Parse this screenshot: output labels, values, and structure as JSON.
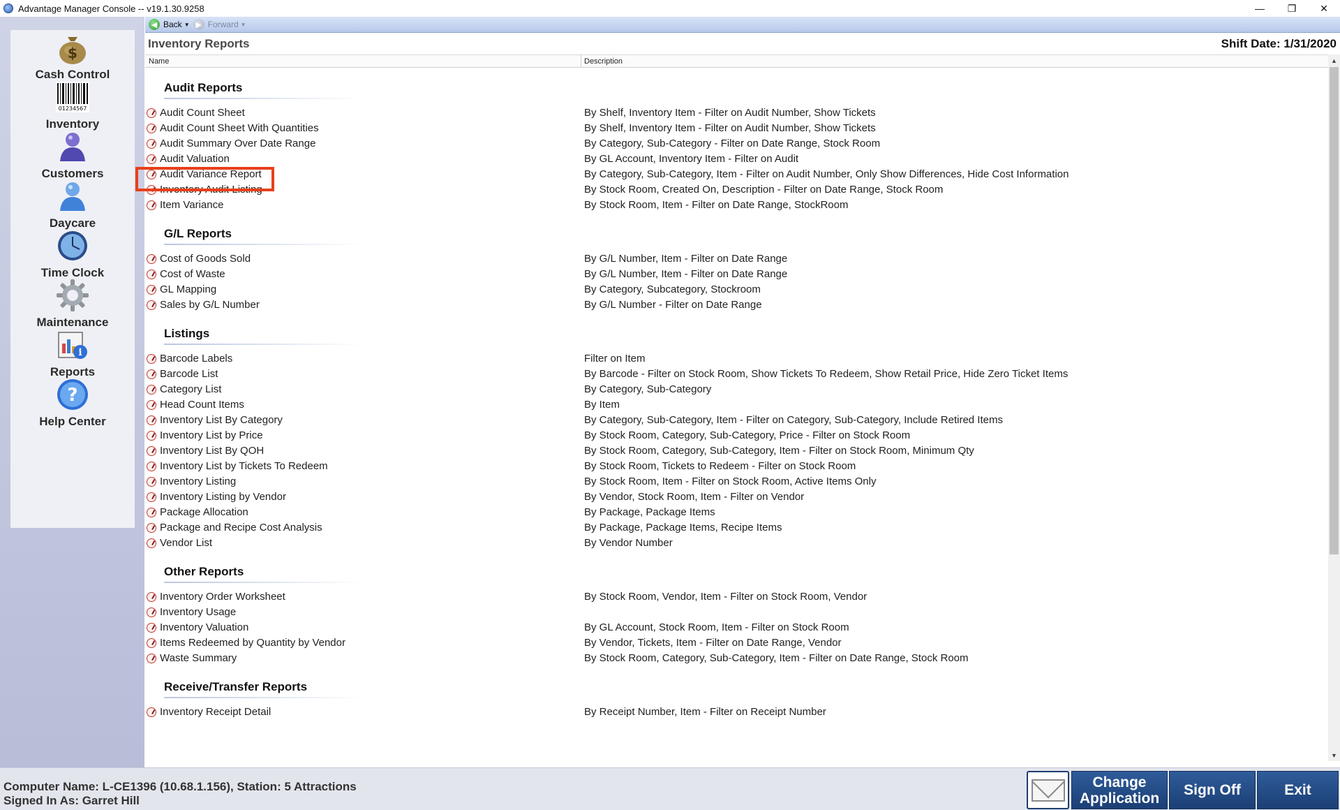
{
  "window": {
    "title": "Advantage Manager Console -- v19.1.30.9258",
    "minimize": "—",
    "restore": "❐",
    "close": "✕"
  },
  "sidebar": {
    "items": [
      {
        "label": "Cash Control",
        "icon": "money-bag-icon"
      },
      {
        "label": "Inventory",
        "icon": "barcode-icon"
      },
      {
        "label": "Customers",
        "icon": "customer-person-icon"
      },
      {
        "label": "Daycare",
        "icon": "daycare-person-icon"
      },
      {
        "label": "Time Clock",
        "icon": "clock-icon"
      },
      {
        "label": "Maintenance",
        "icon": "gear-icon"
      },
      {
        "label": "Reports",
        "icon": "reports-icon"
      },
      {
        "label": "Help Center",
        "icon": "help-icon"
      }
    ],
    "barcode_text": "01234567"
  },
  "navbar": {
    "back": "Back",
    "forward": "Forward"
  },
  "page": {
    "title": "Inventory Reports",
    "shift_date": "Shift Date: 1/31/2020"
  },
  "columns": {
    "name": "Name",
    "description": "Description"
  },
  "sections": [
    {
      "title": "Audit Reports",
      "rows": [
        {
          "name": "Audit Count Sheet",
          "desc": "By Shelf, Inventory Item - Filter on Audit Number, Show Tickets"
        },
        {
          "name": "Audit Count Sheet With Quantities",
          "desc": "By Shelf, Inventory Item - Filter on Audit Number, Show Tickets"
        },
        {
          "name": "Audit Summary Over Date Range",
          "desc": "By Category, Sub-Category - Filter on Date Range, Stock Room"
        },
        {
          "name": "Audit Valuation",
          "desc": "By GL Account, Inventory Item - Filter on Audit"
        },
        {
          "name": "Audit Variance Report",
          "desc": "By Category, Sub-Category, Item - Filter on Audit Number, Only Show Differences, Hide Cost Information"
        },
        {
          "name": "Inventory Audit Listing",
          "desc": "By Stock Room, Created On, Description - Filter on Date Range, Stock Room"
        },
        {
          "name": "Item Variance",
          "desc": "By Stock Room, Item - Filter on Date Range, StockRoom"
        }
      ]
    },
    {
      "title": "G/L Reports",
      "rows": [
        {
          "name": "Cost of Goods Sold",
          "desc": "By G/L Number, Item - Filter on Date Range"
        },
        {
          "name": "Cost of Waste",
          "desc": "By G/L Number, Item - Filter on Date Range"
        },
        {
          "name": "GL Mapping",
          "desc": "By Category, Subcategory, Stockroom"
        },
        {
          "name": "Sales by G/L Number",
          "desc": "By G/L Number - Filter on Date Range"
        }
      ]
    },
    {
      "title": "Listings",
      "rows": [
        {
          "name": "Barcode Labels",
          "desc": "Filter on Item"
        },
        {
          "name": "Barcode List",
          "desc": "By Barcode - Filter on Stock Room, Show Tickets To Redeem, Show Retail Price, Hide Zero Ticket Items"
        },
        {
          "name": "Category List",
          "desc": "By Category, Sub-Category"
        },
        {
          "name": "Head Count Items",
          "desc": "By Item"
        },
        {
          "name": "Inventory List By Category",
          "desc": "By Category, Sub-Category, Item - Filter on Category, Sub-Category, Include Retired Items"
        },
        {
          "name": "Inventory List by Price",
          "desc": "By Stock Room, Category, Sub-Category, Price - Filter on Stock Room"
        },
        {
          "name": "Inventory List By QOH",
          "desc": "By Stock Room, Category, Sub-Category, Item - Filter on Stock Room, Minimum Qty"
        },
        {
          "name": "Inventory List by Tickets To Redeem",
          "desc": "By Stock Room, Tickets to Redeem - Filter on Stock Room"
        },
        {
          "name": "Inventory Listing",
          "desc": "By Stock Room, Item - Filter on Stock Room, Active Items Only"
        },
        {
          "name": "Inventory Listing by Vendor",
          "desc": "By Vendor, Stock Room, Item - Filter on Vendor"
        },
        {
          "name": "Package Allocation",
          "desc": "By Package, Package Items"
        },
        {
          "name": "Package and Recipe Cost Analysis",
          "desc": "By Package, Package Items, Recipe Items"
        },
        {
          "name": "Vendor List",
          "desc": "By Vendor Number"
        }
      ]
    },
    {
      "title": "Other Reports",
      "rows": [
        {
          "name": "Inventory Order Worksheet",
          "desc": "By Stock Room, Vendor, Item - Filter on Stock Room, Vendor"
        },
        {
          "name": "Inventory Usage",
          "desc": ""
        },
        {
          "name": "Inventory Valuation",
          "desc": "By GL Account, Stock Room, Item - Filter on Stock Room"
        },
        {
          "name": "Items Redeemed by Quantity by Vendor",
          "desc": "By Vendor, Tickets, Item - Filter on Date Range, Vendor"
        },
        {
          "name": "Waste Summary",
          "desc": "By Stock Room, Category, Sub-Category, Item - Filter on Date Range, Stock Room"
        }
      ]
    },
    {
      "title": "Receive/Transfer Reports",
      "rows": [
        {
          "name": "Inventory Receipt Detail",
          "desc": "By Receipt Number, Item - Filter on Receipt Number"
        }
      ]
    }
  ],
  "status": {
    "computer": "Computer Name: L-CE1396 (10.68.1.156), Station: 5 Attractions",
    "signed_in": "Signed In As: Garret Hill"
  },
  "buttons": {
    "change_application": "Change Application",
    "sign_off": "Sign Off",
    "exit": "Exit"
  },
  "colors": {
    "accent_button": "#1b3f75",
    "highlight_box": "#e8401c"
  }
}
